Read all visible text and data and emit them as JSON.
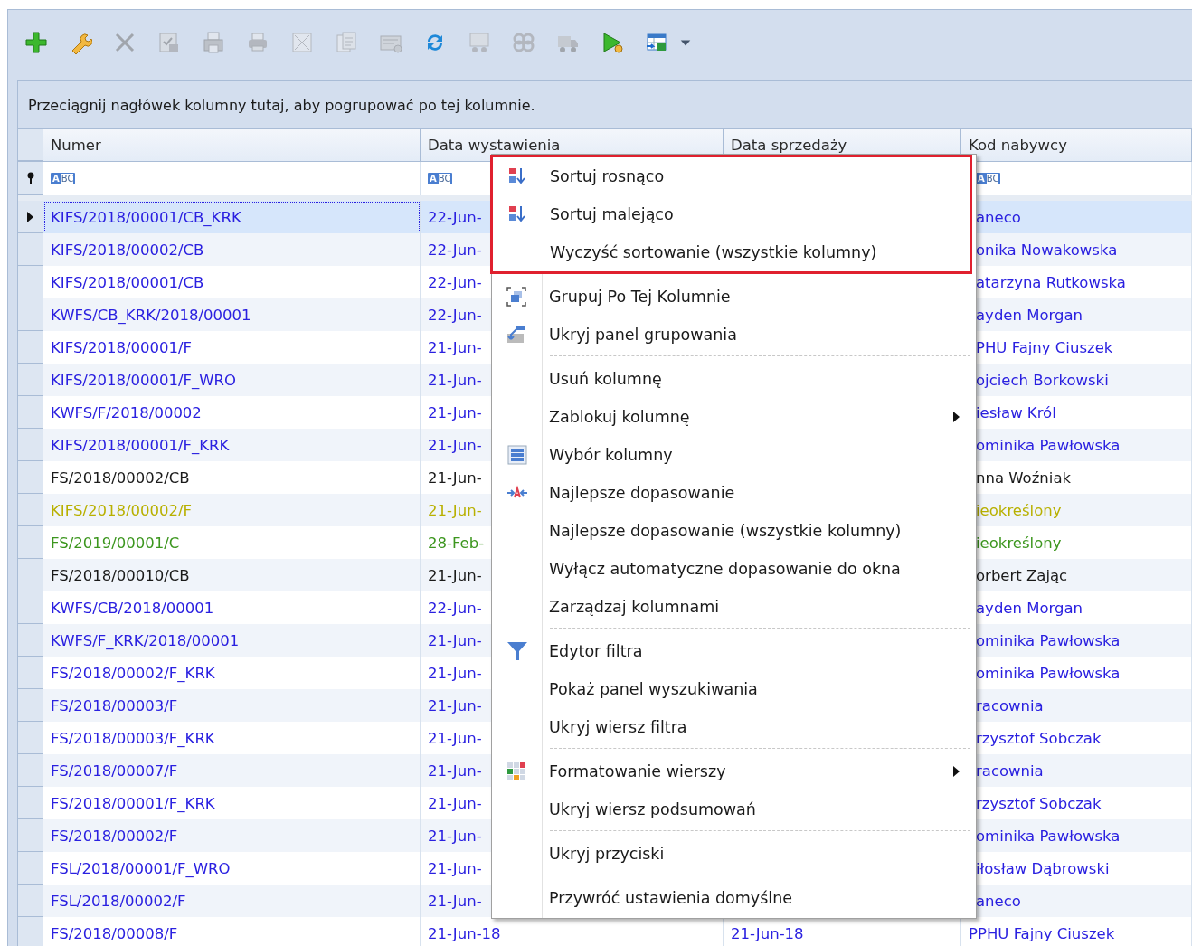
{
  "toolbar": [
    {
      "kind": "add",
      "disabled": false
    },
    {
      "kind": "wrench",
      "disabled": false
    },
    {
      "kind": "delete",
      "disabled": true
    },
    {
      "kind": "save",
      "disabled": true
    },
    {
      "kind": "save-print",
      "disabled": true
    },
    {
      "kind": "print",
      "disabled": true
    },
    {
      "kind": "cancel-doc",
      "disabled": true
    },
    {
      "kind": "copy-doc",
      "disabled": true
    },
    {
      "kind": "card",
      "disabled": true
    },
    {
      "kind": "refresh",
      "disabled": false
    },
    {
      "kind": "cart",
      "disabled": true
    },
    {
      "kind": "link",
      "disabled": true
    },
    {
      "kind": "truck",
      "disabled": true
    },
    {
      "kind": "play",
      "disabled": false
    },
    {
      "kind": "export",
      "disabled": false
    },
    {
      "kind": "dropdown",
      "disabled": false
    }
  ],
  "group_panel": {
    "hint": "Przeciągnij nagłówek kolumny tutaj, aby pogrupować po tej kolumnie."
  },
  "table": {
    "columns": [
      {
        "label": "Numer",
        "filter_icon": "ABC"
      },
      {
        "label": "Data wystawienia",
        "filter_icon": "ABC"
      },
      {
        "label": "Data sprzedaży"
      },
      {
        "label": "Kod nabywcy",
        "filter_icon": "ABC"
      }
    ],
    "rows": [
      {
        "numer": "KIFS/2018/00001/CB_KRK",
        "data_wystawienia": "22-Jun-",
        "kod_nabywcy": "aneco",
        "color": "#2a20e0",
        "selected": true
      },
      {
        "numer": "KIFS/2018/00002/CB",
        "data_wystawienia": "22-Jun-",
        "kod_nabywcy": "onika Nowakowska",
        "color": "#2a20e0",
        "selected": false
      },
      {
        "numer": "KIFS/2018/00001/CB",
        "data_wystawienia": "22-Jun-",
        "kod_nabywcy": "atarzyna Rutkowska",
        "color": "#2a20e0",
        "selected": false
      },
      {
        "numer": "KWFS/CB_KRK/2018/00001",
        "data_wystawienia": "22-Jun-",
        "kod_nabywcy": "ayden Morgan",
        "color": "#2a20e0",
        "selected": false
      },
      {
        "numer": "KIFS/2018/00001/F",
        "data_wystawienia": "21-Jun-",
        "kod_nabywcy": "PHU Fajny Ciuszek",
        "color": "#2a20e0",
        "selected": false
      },
      {
        "numer": "KIFS/2018/00001/F_WRO",
        "data_wystawienia": "21-Jun-",
        "kod_nabywcy": "ojciech Borkowski",
        "color": "#2a20e0",
        "selected": false
      },
      {
        "numer": "KWFS/F/2018/00002",
        "data_wystawienia": "21-Jun-",
        "kod_nabywcy": "iesław Król",
        "color": "#2a20e0",
        "selected": false
      },
      {
        "numer": "KIFS/2018/00001/F_KRK",
        "data_wystawienia": "21-Jun-",
        "kod_nabywcy": "ominika Pawłowska",
        "color": "#2a20e0",
        "selected": false
      },
      {
        "numer": "FS/2018/00002/CB",
        "data_wystawienia": "21-Jun-",
        "kod_nabywcy": "nna Woźniak",
        "color": "#1a1a1a",
        "selected": false
      },
      {
        "numer": "KIFS/2018/00002/F",
        "data_wystawienia": "21-Jun-",
        "kod_nabywcy": "ieokreślony",
        "color": "#b8b000",
        "selected": false
      },
      {
        "numer": "FS/2019/00001/C",
        "data_wystawienia": "28-Feb-",
        "kod_nabywcy": "ieokreślony",
        "color": "#3c961e",
        "selected": false
      },
      {
        "numer": "FS/2018/00010/CB",
        "data_wystawienia": "21-Jun-",
        "kod_nabywcy": "orbert Zając",
        "color": "#1a1a1a",
        "selected": false
      },
      {
        "numer": "KWFS/CB/2018/00001",
        "data_wystawienia": "22-Jun-",
        "kod_nabywcy": "ayden Morgan",
        "color": "#2a20e0",
        "selected": false
      },
      {
        "numer": "KWFS/F_KRK/2018/00001",
        "data_wystawienia": "21-Jun-",
        "kod_nabywcy": "ominika Pawłowska",
        "color": "#2a20e0",
        "selected": false
      },
      {
        "numer": "FS/2018/00002/F_KRK",
        "data_wystawienia": "21-Jun-",
        "kod_nabywcy": "ominika Pawłowska",
        "color": "#2a20e0",
        "selected": false
      },
      {
        "numer": "FS/2018/00003/F",
        "data_wystawienia": "21-Jun-",
        "kod_nabywcy": "racownia",
        "color": "#2a20e0",
        "selected": false
      },
      {
        "numer": "FS/2018/00003/F_KRK",
        "data_wystawienia": "21-Jun-",
        "kod_nabywcy": "rzysztof Sobczak",
        "color": "#2a20e0",
        "selected": false
      },
      {
        "numer": "FS/2018/00007/F",
        "data_wystawienia": "21-Jun-",
        "kod_nabywcy": "racownia",
        "color": "#2a20e0",
        "selected": false
      },
      {
        "numer": "FS/2018/00001/F_KRK",
        "data_wystawienia": "21-Jun-",
        "kod_nabywcy": "rzysztof Sobczak",
        "color": "#2a20e0",
        "selected": false
      },
      {
        "numer": "FS/2018/00002/F",
        "data_wystawienia": "21-Jun-",
        "kod_nabywcy": "ominika Pawłowska",
        "color": "#2a20e0",
        "selected": false
      },
      {
        "numer": "FSL/2018/00001/F_WRO",
        "data_wystawienia": "21-Jun-",
        "kod_nabywcy": "iłosław Dąbrowski",
        "color": "#2a20e0",
        "selected": false
      },
      {
        "numer": "FSL/2018/00002/F",
        "data_wystawienia": "21-Jun-",
        "kod_nabywcy": "aneco",
        "color": "#2a20e0",
        "selected": false
      },
      {
        "numer": "FS/2018/00008/F",
        "data_wystawienia": "21-Jun-18",
        "data_sprzedazy": "21-Jun-18",
        "kod_nabywcy": "PPHU Fajny Ciuszek",
        "color": "#2a20e0",
        "selected": false
      }
    ]
  },
  "context_menu": {
    "groups": [
      {
        "outlined": true,
        "items": [
          {
            "label": "Sortuj rosnąco",
            "kind": "sort-asc",
            "submenu": false
          },
          {
            "label": "Sortuj malejąco",
            "kind": "sort-desc",
            "submenu": false
          },
          {
            "label": "Wyczyść sortowanie (wszystkie kolumny)",
            "kind": "plain",
            "submenu": false
          }
        ]
      },
      {
        "outlined": false,
        "items": [
          {
            "label": "Grupuj Po Tej Kolumnie",
            "kind": "group",
            "submenu": false
          },
          {
            "label": "Ukryj panel grupowania",
            "kind": "hide-panel",
            "submenu": false
          }
        ]
      },
      {
        "outlined": false,
        "items": [
          {
            "label": "Usuń kolumnę",
            "kind": "plain",
            "submenu": false
          },
          {
            "label": "Zablokuj kolumnę",
            "kind": "plain",
            "submenu": true
          },
          {
            "label": "Wybór kolumny",
            "kind": "columns",
            "submenu": false
          },
          {
            "label": "Najlepsze dopasowanie",
            "kind": "fit",
            "submenu": false
          },
          {
            "label": "Najlepsze dopasowanie (wszystkie kolumny)",
            "kind": "plain",
            "submenu": false
          },
          {
            "label": "Wyłącz automatyczne dopasowanie do okna",
            "kind": "plain",
            "submenu": false
          },
          {
            "label": "Zarządzaj kolumnami",
            "kind": "plain",
            "submenu": false
          }
        ]
      },
      {
        "outlined": false,
        "items": [
          {
            "label": "Edytor filtra",
            "kind": "filter",
            "submenu": false
          },
          {
            "label": "Pokaż panel wyszukiwania",
            "kind": "plain",
            "submenu": false
          },
          {
            "label": "Ukryj wiersz filtra",
            "kind": "plain",
            "submenu": false
          }
        ]
      },
      {
        "outlined": false,
        "items": [
          {
            "label": "Formatowanie wierszy",
            "kind": "format",
            "submenu": true
          },
          {
            "label": "Ukryj wiersz podsumowań",
            "kind": "plain",
            "submenu": false
          }
        ]
      },
      {
        "outlined": false,
        "items": [
          {
            "label": "Ukryj przyciski",
            "kind": "plain",
            "submenu": false
          }
        ]
      },
      {
        "outlined": false,
        "items": [
          {
            "label": "Przywróć ustawienia domyślne",
            "kind": "plain",
            "submenu": false
          }
        ]
      }
    ]
  }
}
